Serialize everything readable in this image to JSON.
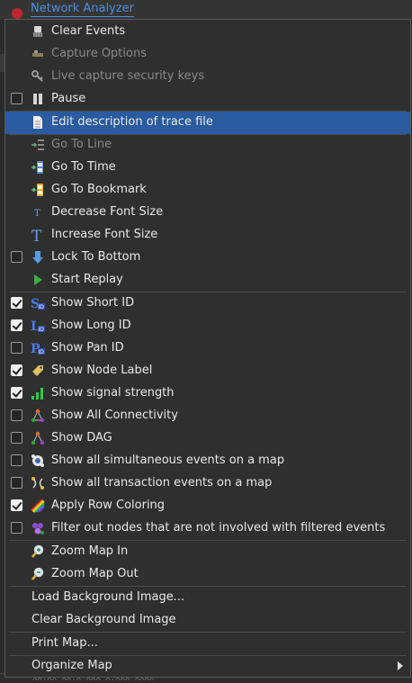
{
  "app": {
    "tab_title": "Network Analyzer"
  },
  "background": {
    "bottom_text": "XX.XX   XX.X XXX   X.XXX   XXXX"
  },
  "menu": {
    "items": [
      {
        "label": "Clear Events",
        "icon": "broom-icon",
        "disabled": false
      },
      {
        "label": "Capture Options",
        "icon": "capture-options-icon",
        "disabled": true
      },
      {
        "label": "Live capture security keys",
        "icon": "key-icon",
        "disabled": true
      },
      {
        "label": "Pause",
        "icon": "pause-icon",
        "checkbox": false
      },
      {
        "label": "Edit description of trace file",
        "icon": "document-icon",
        "highlighted": true
      },
      {
        "label": "Go To Line",
        "icon": "go-to-line-icon",
        "disabled": true
      },
      {
        "label": "Go To Time",
        "icon": "go-to-time-icon"
      },
      {
        "label": "Go To Bookmark",
        "icon": "go-to-bookmark-icon"
      },
      {
        "label": "Decrease Font Size",
        "icon": "decrease-font-icon"
      },
      {
        "label": "Increase Font Size",
        "icon": "increase-font-icon"
      },
      {
        "label": "Lock To Bottom",
        "icon": "down-arrow-icon",
        "checkbox": false
      },
      {
        "label": "Start Replay",
        "icon": "play-icon"
      },
      {
        "label": "Show Short ID",
        "icon": "short-id-icon",
        "checkbox": true
      },
      {
        "label": "Show Long ID",
        "icon": "long-id-icon",
        "checkbox": true
      },
      {
        "label": "Show Pan ID",
        "icon": "pan-id-icon",
        "checkbox": false
      },
      {
        "label": "Show Node Label",
        "icon": "tag-icon",
        "checkbox": true
      },
      {
        "label": "Show signal strength",
        "icon": "signal-strength-icon",
        "checkbox": true
      },
      {
        "label": "Show All Connectivity",
        "icon": "connectivity-icon",
        "checkbox": false
      },
      {
        "label": "Show DAG",
        "icon": "dag-icon",
        "checkbox": false
      },
      {
        "label": "Show all simultaneous events on a map",
        "icon": "simultaneous-events-icon",
        "checkbox": false
      },
      {
        "label": "Show all transaction events on a map",
        "icon": "transaction-events-icon",
        "checkbox": false
      },
      {
        "label": "Apply Row Coloring",
        "icon": "rainbow-icon",
        "checkbox": true
      },
      {
        "label": "Filter out nodes that are not involved with filtered events",
        "icon": "filter-nodes-icon",
        "checkbox": false
      },
      {
        "label": "Zoom Map In",
        "icon": "zoom-in-icon"
      },
      {
        "label": "Zoom Map Out",
        "icon": "zoom-out-icon"
      },
      {
        "label": "Load Background Image..."
      },
      {
        "label": "Clear Background Image"
      },
      {
        "label": "Print Map..."
      },
      {
        "label": "Organize Map",
        "submenu": true
      }
    ]
  },
  "colors": {
    "highlight": "#2a5aa0",
    "menu_bg": "#2f2f2f",
    "disabled_text": "#8a8a8a"
  }
}
